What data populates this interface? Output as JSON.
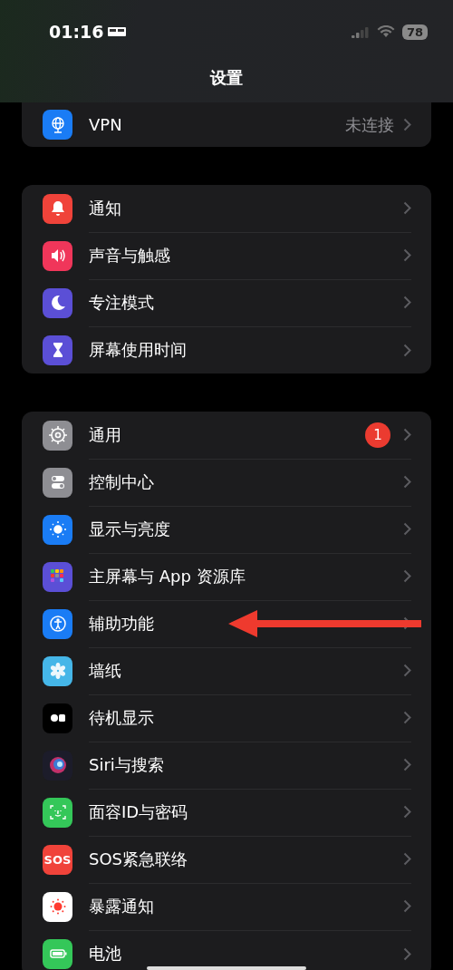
{
  "status_bar": {
    "time": "01:16",
    "battery": "78"
  },
  "nav": {
    "title": "设置"
  },
  "groups": [
    {
      "items": [
        {
          "label": "VPN",
          "kind": "globe",
          "color": "#1a7cf5",
          "value": "未连接"
        }
      ]
    },
    {
      "items": [
        {
          "label": "通知",
          "kind": "bell",
          "color": "#f0433a"
        },
        {
          "label": "声音与触感",
          "kind": "speaker",
          "color": "#f0365a"
        },
        {
          "label": "专注模式",
          "kind": "moon",
          "color": "#5b4fd6"
        },
        {
          "label": "屏幕使用时间",
          "kind": "hourglass",
          "color": "#5b4fd6"
        }
      ]
    },
    {
      "items": [
        {
          "label": "通用",
          "kind": "gear",
          "color": "#8e8e93",
          "badge": "1"
        },
        {
          "label": "控制中心",
          "kind": "toggles",
          "color": "#8e8e93"
        },
        {
          "label": "显示与亮度",
          "kind": "sun",
          "color": "#1a7cf5"
        },
        {
          "label": "主屏幕与 App 资源库",
          "kind": "grid",
          "color": "#5b4fd6"
        },
        {
          "label": "辅助功能",
          "kind": "accessibility",
          "color": "#1a7cf5",
          "annotated": true
        },
        {
          "label": "墙纸",
          "kind": "flower",
          "color": "#45b6e8"
        },
        {
          "label": "待机显示",
          "kind": "standby",
          "color": "#000000"
        },
        {
          "label": "Siri与搜索",
          "kind": "siri",
          "color": "#1c1c2a"
        },
        {
          "label": "面容ID与密码",
          "kind": "faceid",
          "color": "#34c759"
        },
        {
          "label": "SOS紧急联络",
          "kind": "sos",
          "color": "#f0433a",
          "icon_label": "SOS"
        },
        {
          "label": "暴露通知",
          "kind": "exposure",
          "color": "#ffffff"
        },
        {
          "label": "电池",
          "kind": "battery",
          "color": "#34c759"
        }
      ]
    }
  ]
}
